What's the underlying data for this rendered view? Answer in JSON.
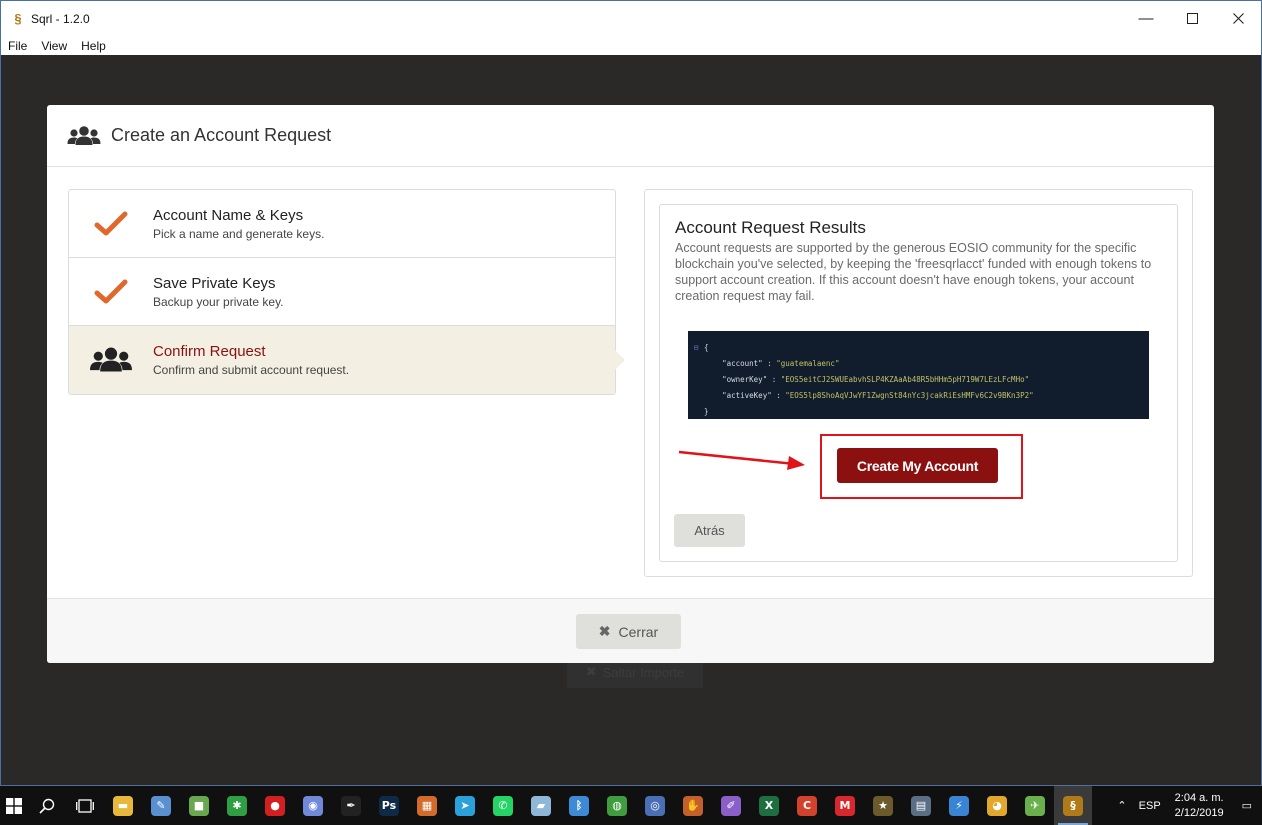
{
  "window": {
    "title": "Sqrl - 1.2.0",
    "menu": [
      "File",
      "View",
      "Help"
    ]
  },
  "background": {
    "ghost_button_label": "Saltar Importe"
  },
  "modal": {
    "title": "Create an Account Request",
    "steps": [
      {
        "title": "Account Name & Keys",
        "desc": "Pick a name and generate keys.",
        "status": "complete"
      },
      {
        "title": "Save Private Keys",
        "desc": "Backup your private key.",
        "status": "complete"
      },
      {
        "title": "Confirm Request",
        "desc": "Confirm and submit account request.",
        "status": "active"
      }
    ],
    "results": {
      "title": "Account Request Results",
      "description": "Account requests are supported by the generous EOSIO community for the specific blockchain you've selected, by keeping the 'freesqrlacct' funded with enough tokens to support account creation. If this account doesn't have enough tokens, your account creation request may fail.",
      "code": {
        "open_brace": "{",
        "close_brace": "}",
        "fold_marker": "⊟",
        "lines": [
          {
            "key": "\"account\"",
            "value": "\"guatemalaenc\""
          },
          {
            "key": "\"ownerKey\"",
            "value": "\"EOS5eitCJ2SWUEabvhSLP4KZAaAb48R5bHHm5pH719W7LEzLFcMHo\""
          },
          {
            "key": "\"activeKey\"",
            "value": "\"EOS5lp8ShoAqVJwYF1ZwgnSt84nYc3jcakRiEsHMFv6C2v9BKn3P2\""
          }
        ]
      },
      "create_button": "Create My Account",
      "back_button": "Atrás"
    },
    "close_button": "Cerrar"
  },
  "taskbar": {
    "language": "ESP",
    "time": "2:04 a. m.",
    "date": "2/12/2019",
    "apps": [
      {
        "name": "file-explorer",
        "glyph": "▬",
        "color": "#e8b83a"
      },
      {
        "name": "paint",
        "glyph": "✎",
        "color": "#5a8fd0"
      },
      {
        "name": "app-green",
        "glyph": "■",
        "color": "#6aa84f"
      },
      {
        "name": "network-app",
        "glyph": "✱",
        "color": "#2ea043"
      },
      {
        "name": "record",
        "glyph": "●",
        "color": "#d21f1f"
      },
      {
        "name": "discord",
        "glyph": "◉",
        "color": "#7289da"
      },
      {
        "name": "inkscape",
        "glyph": "✒",
        "color": "#222222"
      },
      {
        "name": "photoshop",
        "glyph": "Ps",
        "color": "#0e2a47"
      },
      {
        "name": "app-colorful",
        "glyph": "▦",
        "color": "#d36b2b"
      },
      {
        "name": "telegram",
        "glyph": "➤",
        "color": "#2aa1da"
      },
      {
        "name": "whatsapp",
        "glyph": "✆",
        "color": "#25d366"
      },
      {
        "name": "book-app",
        "glyph": "▰",
        "color": "#8fb8d8"
      },
      {
        "name": "bluetooth-app",
        "glyph": "ᛒ",
        "color": "#3d8bd6"
      },
      {
        "name": "globe-app",
        "glyph": "◍",
        "color": "#3f9d3f"
      },
      {
        "name": "disk-app",
        "glyph": "◎",
        "color": "#4a6fb5"
      },
      {
        "name": "baseball-app",
        "glyph": "✋",
        "color": "#c4602a"
      },
      {
        "name": "feather-app",
        "glyph": "✐",
        "color": "#8a5fc8"
      },
      {
        "name": "excel",
        "glyph": "X",
        "color": "#1d6f42"
      },
      {
        "name": "ccleaner",
        "glyph": "C",
        "color": "#d2422c"
      },
      {
        "name": "mega",
        "glyph": "M",
        "color": "#d9272e"
      },
      {
        "name": "star-app",
        "glyph": "★",
        "color": "#6b5a2b"
      },
      {
        "name": "calculator",
        "glyph": "▤",
        "color": "#5a6e86"
      },
      {
        "name": "lightning-app",
        "glyph": "⚡",
        "color": "#3a84d6"
      },
      {
        "name": "chrome",
        "glyph": "◕",
        "color": "#e2a82b"
      },
      {
        "name": "hummingbird-app",
        "glyph": "✈",
        "color": "#6ab04c"
      },
      {
        "name": "sqrl",
        "glyph": "§",
        "color": "#b07a19"
      }
    ]
  },
  "colors": {
    "accent": "#8b1111",
    "check": "#e1672a",
    "annotation_red": "#e0131a",
    "code_bg": "#111c2c"
  }
}
